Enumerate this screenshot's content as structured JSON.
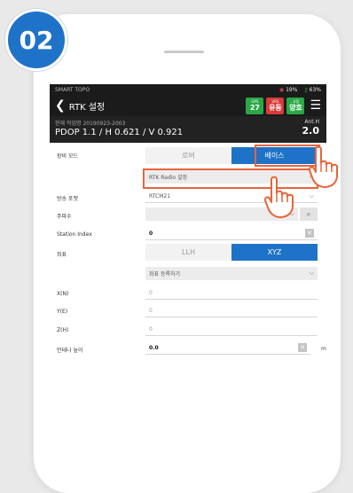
{
  "step_badge": "02",
  "status_bar": {
    "app_name": "SMART TOPO",
    "signal": "19%",
    "battery": "63%"
  },
  "header": {
    "back_icon": "chevron-left-icon",
    "title": "RTK 설정",
    "indicators": [
      {
        "small": "GPS",
        "big": "27",
        "color": "#2aa845"
      },
      {
        "small": "VRS",
        "big": "유동",
        "color": "#d83a3a"
      },
      {
        "small": "고정",
        "big": "양호",
        "color": "#2aa845"
      }
    ],
    "menu_icon": "hamburger-menu-icon"
  },
  "info_bar": {
    "work_label": "현재 작업명",
    "work_name": "20190923-2003",
    "dop_line": "PDOP 1.1 / H 0.621 / V 0.921",
    "ant_label": "Ant.H",
    "ant_value": "2.0"
  },
  "form": {
    "equipment_mode": {
      "label": "장비 모드",
      "options": [
        "로버",
        "베이스"
      ],
      "selected": "베이스"
    },
    "rtk_dropdown": {
      "value": "RTK Radio 설정"
    },
    "broadcast_format": {
      "label": "방송 포맷",
      "value": "RTCM21"
    },
    "frequency": {
      "label": "주파수",
      "value": ""
    },
    "station_index": {
      "label": "Station Index",
      "value": "0"
    },
    "coordinate": {
      "label": "좌표",
      "options": [
        "LLH",
        "XYZ"
      ],
      "selected": "XYZ"
    },
    "coord_register": {
      "value": "좌표 등록하기"
    },
    "x": {
      "label": "X(N)",
      "value": "0"
    },
    "y": {
      "label": "Y(E)",
      "value": "0"
    },
    "z": {
      "label": "Z(H)",
      "value": "0"
    },
    "antenna_height": {
      "label": "안테나 높이",
      "value": "0.0",
      "unit": "m"
    }
  },
  "colors": {
    "accent": "#1e73c8",
    "highlight": "#e8643a",
    "dark_bar": "#1b1b1b"
  }
}
